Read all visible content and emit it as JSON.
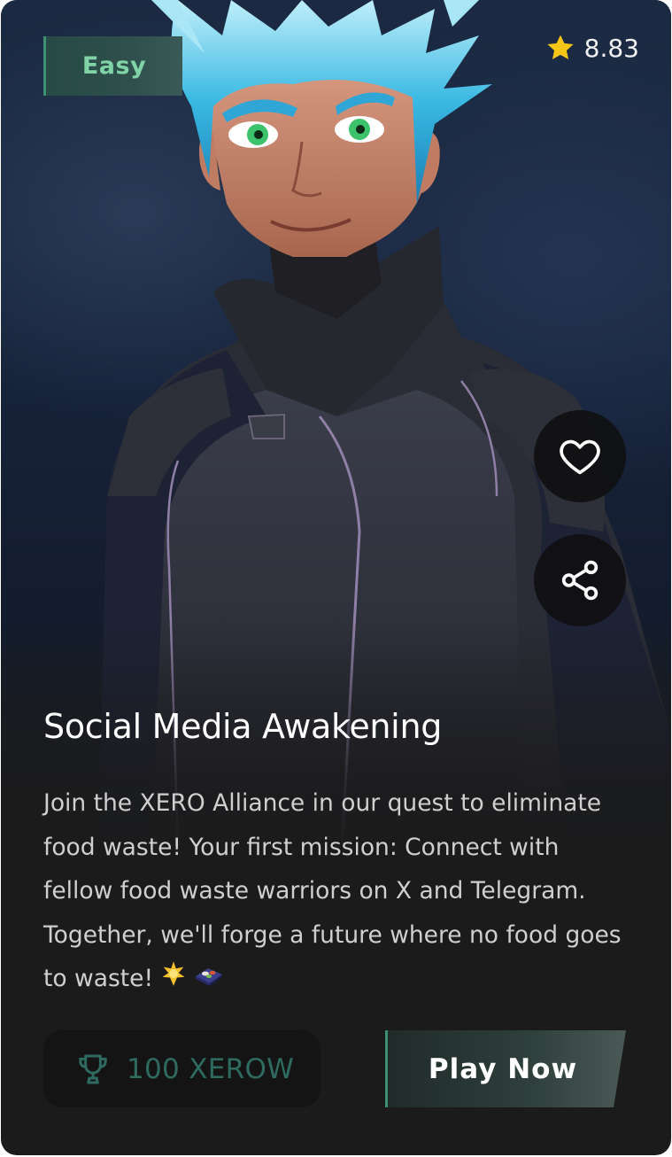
{
  "quest": {
    "difficulty": "Easy",
    "rating": "8.83",
    "title": "Social Media Awakening",
    "description": "Join the XERO Alliance in our quest to eliminate food waste! Your first mission: Connect with fellow food waste warriors on X and Telegram. Together, we'll forge a future where no food goes to waste!",
    "description_emojis": [
      "sparkle-star-emoji",
      "food-tray-emoji"
    ],
    "reward": "100 XEROW",
    "play_label": "Play Now"
  },
  "icons": {
    "rating": "star-icon",
    "like": "heart-icon",
    "share": "share-icon",
    "reward": "trophy-icon"
  },
  "colors": {
    "difficulty_text": "#7fd3a6",
    "difficulty_bg": "#2e4f4b",
    "accent_green": "#3f8f73",
    "star": "#f5c518",
    "reward_text": "#2e6a5f",
    "card_bg": "#1b1b1c"
  }
}
